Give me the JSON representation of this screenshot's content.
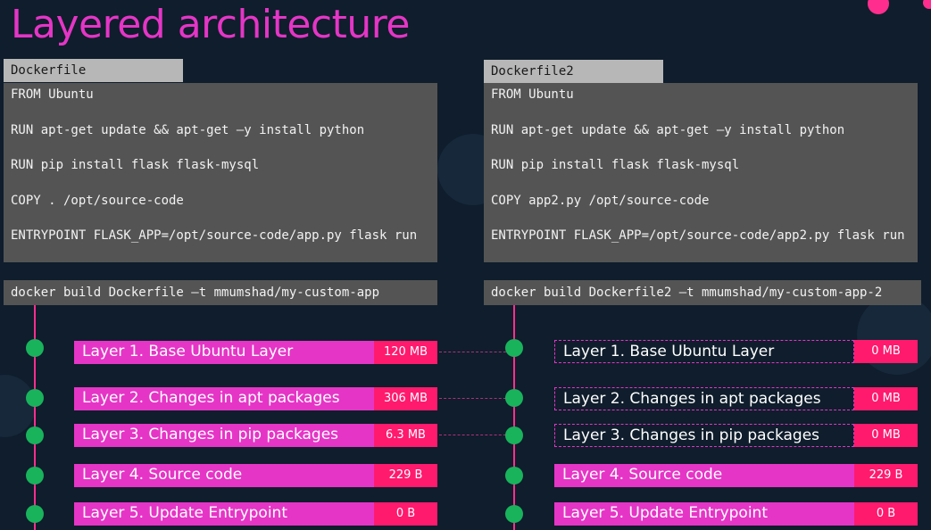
{
  "title": "Layered architecture",
  "left": {
    "tab": "Dockerfile",
    "lines": [
      "FROM Ubuntu",
      "RUN apt-get update && apt-get –y install python",
      "RUN pip install flask flask-mysql",
      "COPY . /opt/source-code",
      "ENTRYPOINT FLASK_APP=/opt/source-code/app.py flask run"
    ],
    "command": "docker build Dockerfile –t mmumshad/my-custom-app",
    "layers": [
      {
        "label": "Layer 1. Base Ubuntu Layer",
        "size": "120 MB"
      },
      {
        "label": "Layer 2. Changes in apt packages",
        "size": "306 MB"
      },
      {
        "label": "Layer 3. Changes in pip packages",
        "size": "6.3 MB"
      },
      {
        "label": "Layer 4. Source code",
        "size": "229 B"
      },
      {
        "label": "Layer 5. Update Entrypoint",
        "size": "0 B"
      }
    ]
  },
  "right": {
    "tab": "Dockerfile2",
    "lines": [
      "FROM Ubuntu",
      "RUN apt-get update && apt-get –y install python",
      "RUN pip install flask flask-mysql",
      "COPY app2.py /opt/source-code",
      "ENTRYPOINT FLASK_APP=/opt/source-code/app2.py flask run"
    ],
    "command": "docker build Dockerfile2 –t mmumshad/my-custom-app-2",
    "layers": [
      {
        "label": "Layer 1. Base Ubuntu Layer",
        "size": "0 MB",
        "cached": true
      },
      {
        "label": "Layer 2. Changes in apt packages",
        "size": "0 MB",
        "cached": true
      },
      {
        "label": "Layer 3. Changes in pip packages",
        "size": "0 MB",
        "cached": true
      },
      {
        "label": "Layer 4. Source code",
        "size": "229 B",
        "cached": false
      },
      {
        "label": "Layer 5. Update Entrypoint",
        "size": "0 B",
        "cached": false
      }
    ]
  },
  "colors": {
    "title": "#e535c6",
    "layer_fill": "#e535c6",
    "size_fill": "#ff1a6e",
    "node": "#19b35c",
    "timeline": "#ff2e8e",
    "code_bg": "#545454",
    "tab_bg": "#b7b7b7",
    "background": "#0f1d2c"
  }
}
